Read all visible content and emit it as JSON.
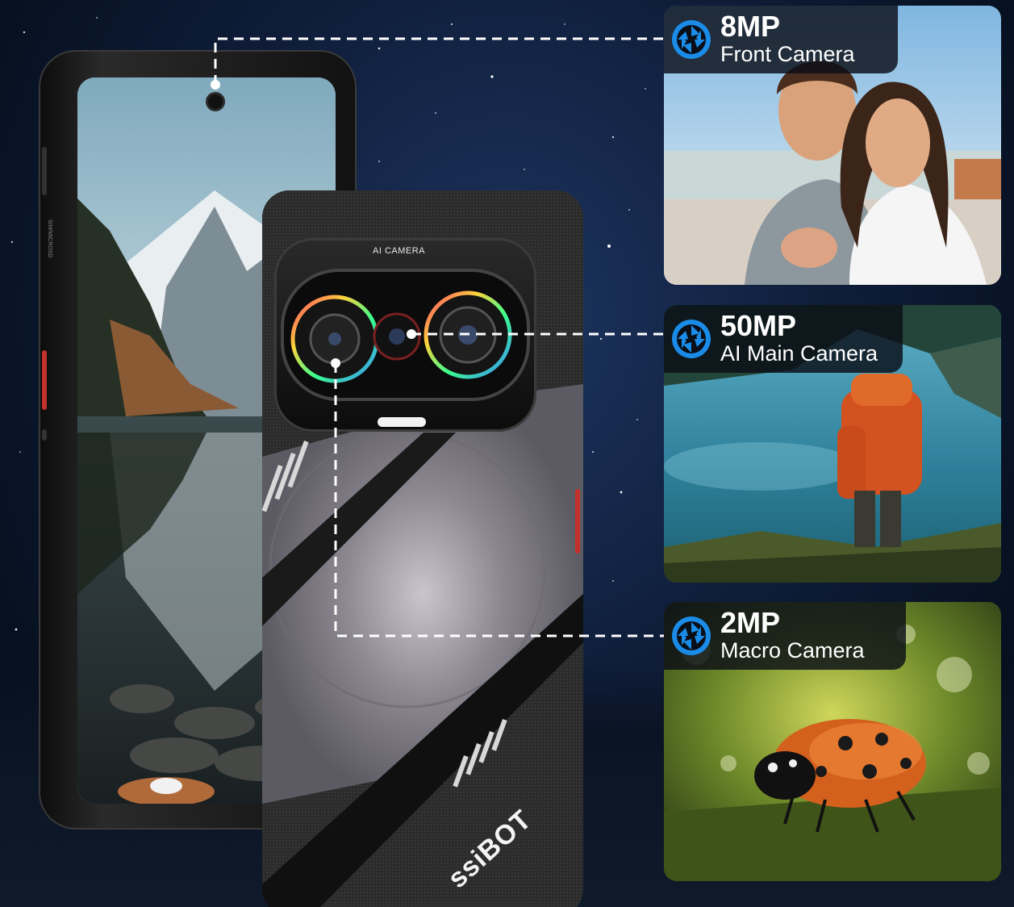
{
  "phone": {
    "camera_module_label": "AI CAMERA",
    "brand": "ssiBOT",
    "sim_label": "SIM/MICROSD"
  },
  "cards": [
    {
      "mp": "8MP",
      "name": "Front Camera",
      "icon": "aperture-icon",
      "scene": "selfie-couple"
    },
    {
      "mp": "50MP",
      "name": "AI Main Camera",
      "icon": "aperture-icon",
      "scene": "hiker-by-lake"
    },
    {
      "mp": "2MP",
      "name": "Macro Camera",
      "icon": "aperture-icon",
      "scene": "ladybug-closeup"
    }
  ],
  "colors": {
    "accent_blue": "#1a8ce8",
    "leader_line": "#ffffff",
    "header_bg": "#0a0e16"
  }
}
